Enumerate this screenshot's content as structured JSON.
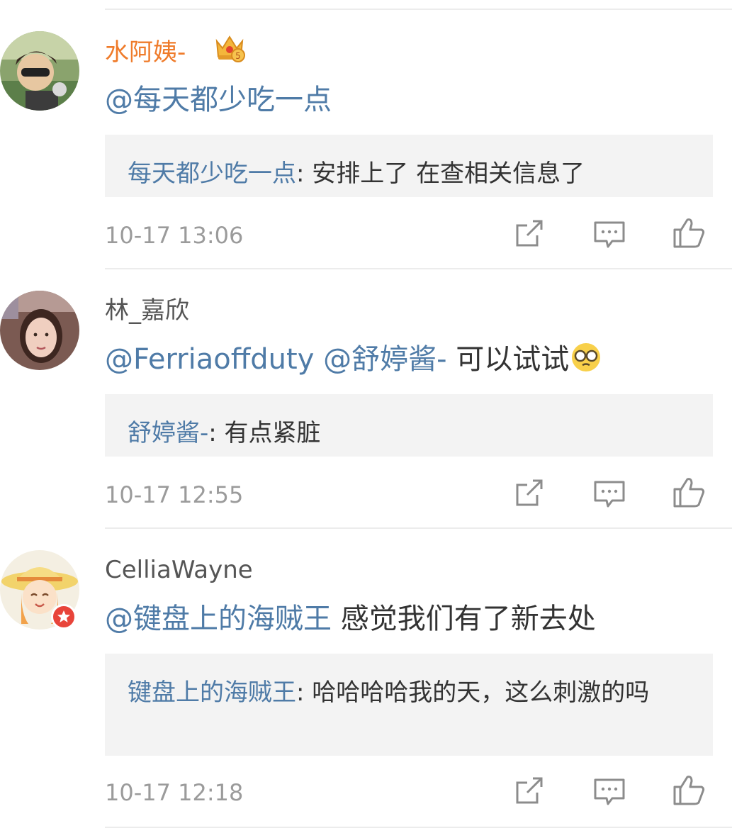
{
  "comments": [
    {
      "user": "水阿姨-",
      "mention": "@每天都少吃一点",
      "text": "",
      "quote_author": "每天都少吃一点",
      "quote_sep": ": ",
      "quote_text": "安排上了 在查相关信息了",
      "time": "10-17 13:06"
    },
    {
      "user": "林_嘉欣",
      "mention": "@Ferriaoffduty @舒婷酱-",
      "text": "  可以试试",
      "quote_author": "舒婷酱-",
      "quote_sep": ": ",
      "quote_text": "有点紧脏",
      "time": "10-17 12:55"
    },
    {
      "user": "CelliaWayne",
      "mention": "@键盘上的海贼王",
      "text": " 感觉我们有了新去处",
      "quote_author": "键盘上的海贼王",
      "quote_sep": ": ",
      "quote_text": "哈哈哈哈我的天，这么刺激的吗",
      "time": "10-17 12:18"
    }
  ],
  "icons": {
    "share": "share-icon",
    "comment": "comment-icon",
    "like": "thumbs-up-icon",
    "crown": "vip-crown-icon",
    "emoji": "glasses-emoji-icon"
  },
  "colors": {
    "vip_name": "#ef7b2a",
    "mention": "#4f7ba7",
    "time": "#9b9b9b",
    "quote_bg": "#f3f3f3"
  }
}
